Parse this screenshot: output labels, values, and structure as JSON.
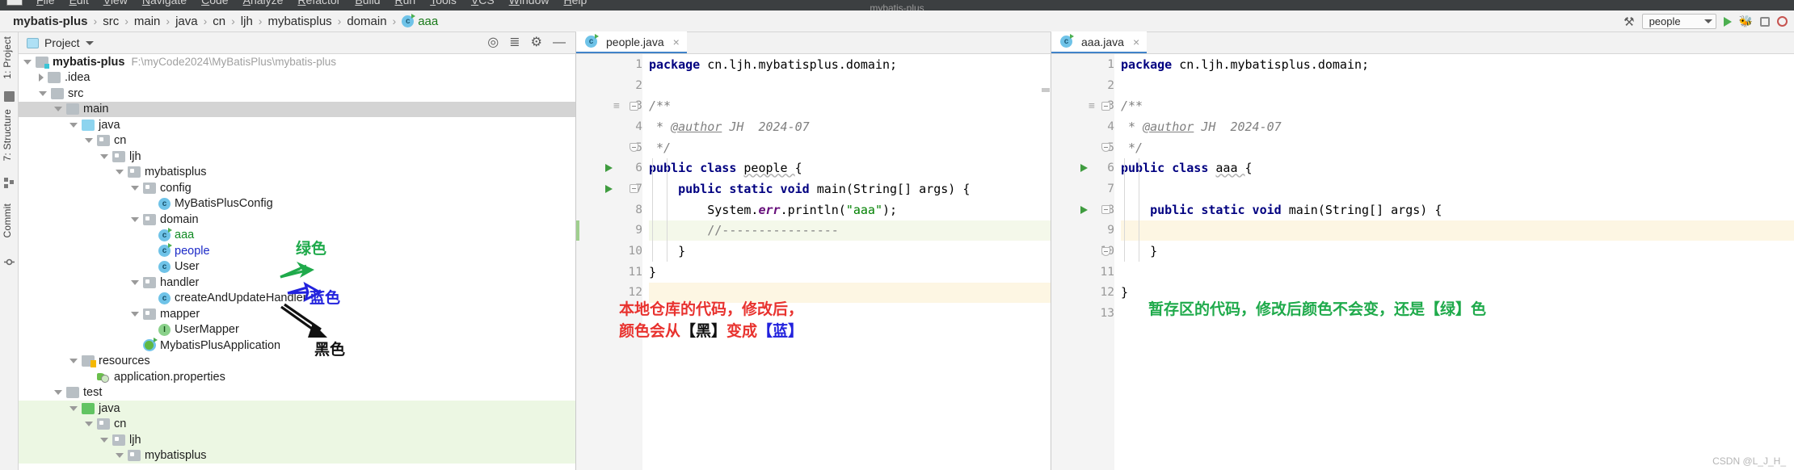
{
  "menubar": {
    "items": [
      "File",
      "Edit",
      "View",
      "Navigate",
      "Code",
      "Analyze",
      "Refactor",
      "Build",
      "Run",
      "Tools",
      "VCS",
      "Window",
      "Help"
    ],
    "window_title": "mybatis-plus"
  },
  "breadcrumb": {
    "segments": [
      "mybatis-plus",
      "src",
      "main",
      "java",
      "cn",
      "ljh",
      "mybatisplus",
      "domain",
      "aaa"
    ],
    "separator": "›",
    "last_icon": "java-class-modified-icon"
  },
  "toolbar_right": {
    "hammer_label": "⚒",
    "run_config": "people",
    "run_label": "▶",
    "debug_label": "ƀ",
    "stop_label": "■",
    "record_label": "●"
  },
  "toolstrip": {
    "tabs": [
      "1: Project",
      "7: Structure",
      "Commit"
    ]
  },
  "project_panel": {
    "header_title": "Project",
    "icons": [
      "locate-icon",
      "collapse-all-icon",
      "settings-gear-icon",
      "hide-panel-icon"
    ],
    "tree": [
      {
        "depth": 0,
        "label": "mybatis-plus",
        "path": "F:\\myCode2024\\MyBatisPlus\\mybatis-plus",
        "arrow": "open",
        "icon": "module",
        "style": "bold"
      },
      {
        "depth": 1,
        "label": ".idea",
        "arrow": "closed",
        "icon": "folder-plain"
      },
      {
        "depth": 1,
        "label": "src",
        "arrow": "open",
        "icon": "folder-plain"
      },
      {
        "depth": 2,
        "label": "main",
        "arrow": "open",
        "icon": "folder-plain",
        "selected": true
      },
      {
        "depth": 3,
        "label": "java",
        "arrow": "open",
        "icon": "folder-blue2"
      },
      {
        "depth": 4,
        "label": "cn",
        "arrow": "open",
        "icon": "folder-gray"
      },
      {
        "depth": 5,
        "label": "ljh",
        "arrow": "open",
        "icon": "folder-gray"
      },
      {
        "depth": 6,
        "label": "mybatisplus",
        "arrow": "open",
        "icon": "folder-gray"
      },
      {
        "depth": 7,
        "label": "config",
        "arrow": "open",
        "icon": "folder-gray"
      },
      {
        "depth": 8,
        "label": "MyBatisPlusConfig",
        "arrow": "none",
        "icon": "class"
      },
      {
        "depth": 7,
        "label": "domain",
        "arrow": "open",
        "icon": "folder-gray"
      },
      {
        "depth": 8,
        "label": "aaa",
        "arrow": "none",
        "icon": "class-modified",
        "style": "green"
      },
      {
        "depth": 8,
        "label": "people",
        "arrow": "none",
        "icon": "class-modified",
        "style": "blue"
      },
      {
        "depth": 8,
        "label": "User",
        "arrow": "none",
        "icon": "class"
      },
      {
        "depth": 7,
        "label": "handler",
        "arrow": "open",
        "icon": "folder-gray"
      },
      {
        "depth": 8,
        "label": "createAndUpdateHandler",
        "arrow": "none",
        "icon": "class"
      },
      {
        "depth": 7,
        "label": "mapper",
        "arrow": "open",
        "icon": "folder-gray"
      },
      {
        "depth": 8,
        "label": "UserMapper",
        "arrow": "none",
        "icon": "interface"
      },
      {
        "depth": 7,
        "label": "MybatisPlusApplication",
        "arrow": "none",
        "icon": "spring-class"
      },
      {
        "depth": 3,
        "label": "resources",
        "arrow": "open",
        "icon": "folder-resources"
      },
      {
        "depth": 4,
        "label": "application.properties",
        "arrow": "none",
        "icon": "properties"
      },
      {
        "depth": 2,
        "label": "test",
        "arrow": "open",
        "icon": "folder-plain"
      },
      {
        "depth": 3,
        "label": "java",
        "arrow": "open",
        "icon": "folder-green",
        "green_bg": true
      },
      {
        "depth": 4,
        "label": "cn",
        "arrow": "open",
        "icon": "folder-gray",
        "green_bg": true
      },
      {
        "depth": 5,
        "label": "ljh",
        "arrow": "open",
        "icon": "folder-gray",
        "green_bg": true
      },
      {
        "depth": 6,
        "label": "mybatisplus",
        "arrow": "open",
        "icon": "folder-gray",
        "green_bg": true
      }
    ],
    "annotations": [
      {
        "text": "绿色",
        "color": "#1faa4b",
        "name": "green-arrow-label"
      },
      {
        "text": "蓝色",
        "color": "#2222dd",
        "name": "blue-arrow-label"
      },
      {
        "text": "黑色",
        "color": "#111111",
        "name": "black-arrow-label"
      }
    ]
  },
  "editor_left": {
    "tab_label": "people.java",
    "tab_icon": "java-class-modified-icon",
    "close_label": "×",
    "lines": [
      {
        "n": 1,
        "tokens": [
          {
            "t": "package ",
            "c": "kw"
          },
          {
            "t": "cn.ljh.mybatisplus.domain;",
            "c": "plain"
          }
        ]
      },
      {
        "n": 2,
        "tokens": []
      },
      {
        "n": 3,
        "tokens": [
          {
            "t": "/**",
            "c": "cmt"
          }
        ],
        "fold": "start",
        "comment_mark": true
      },
      {
        "n": 4,
        "tokens": [
          {
            "t": " * ",
            "c": "cmt"
          },
          {
            "t": "@author",
            "c": "cmt-tag"
          },
          {
            "t": " JH  2024-07",
            "c": "cmt"
          }
        ]
      },
      {
        "n": 5,
        "tokens": [
          {
            "t": " */",
            "c": "cmt"
          }
        ],
        "fold": "end"
      },
      {
        "n": 6,
        "tokens": [
          {
            "t": "public class ",
            "c": "kw"
          },
          {
            "t": "people ",
            "c": "wavy"
          },
          {
            "t": "{",
            "c": "plain"
          }
        ],
        "run": true
      },
      {
        "n": 7,
        "tokens": [
          {
            "t": "    ",
            "c": "plain"
          },
          {
            "t": "public static void ",
            "c": "kw"
          },
          {
            "t": "main(String[] args) {",
            "c": "plain"
          }
        ],
        "run": true,
        "fold": "start"
      },
      {
        "n": 8,
        "tokens": [
          {
            "t": "        System.",
            "c": "plain"
          },
          {
            "t": "err",
            "c": "fld"
          },
          {
            "t": ".println(",
            "c": "plain"
          },
          {
            "t": "\"aaa\"",
            "c": "str"
          },
          {
            "t": ");",
            "c": "plain"
          }
        ]
      },
      {
        "n": 9,
        "tokens": [
          {
            "t": "        //----------------",
            "c": "cmt-ln"
          }
        ],
        "hl": true,
        "changed": true
      },
      {
        "n": 10,
        "tokens": [
          {
            "t": "    }",
            "c": "plain"
          }
        ]
      },
      {
        "n": 11,
        "tokens": [
          {
            "t": "}",
            "c": "plain"
          }
        ]
      },
      {
        "n": 12,
        "tokens": [],
        "hl_yellow": true
      }
    ],
    "note": {
      "line1_red": "本地仓库的代码，修改后，",
      "line2_a": "颜色会从",
      "line2_black": "【黑】",
      "line2_b": "变成",
      "line2_blue": "【蓝】"
    }
  },
  "editor_right": {
    "tab_label": "aaa.java",
    "tab_icon": "java-class-modified-icon",
    "close_label": "×",
    "lines": [
      {
        "n": 1,
        "tokens": [
          {
            "t": "package ",
            "c": "kw"
          },
          {
            "t": "cn.ljh.mybatisplus.domain;",
            "c": "plain"
          }
        ]
      },
      {
        "n": 2,
        "tokens": []
      },
      {
        "n": 3,
        "tokens": [
          {
            "t": "/**",
            "c": "cmt"
          }
        ],
        "fold": "start",
        "comment_mark": true
      },
      {
        "n": 4,
        "tokens": [
          {
            "t": " * ",
            "c": "cmt"
          },
          {
            "t": "@author",
            "c": "cmt-tag"
          },
          {
            "t": " JH  2024-07",
            "c": "cmt"
          }
        ]
      },
      {
        "n": 5,
        "tokens": [
          {
            "t": " */",
            "c": "cmt"
          }
        ],
        "fold": "end"
      },
      {
        "n": 6,
        "tokens": [
          {
            "t": "public class ",
            "c": "kw"
          },
          {
            "t": "aaa ",
            "c": "wavy"
          },
          {
            "t": "{",
            "c": "plain"
          }
        ],
        "run": true
      },
      {
        "n": 7,
        "tokens": []
      },
      {
        "n": 8,
        "tokens": [
          {
            "t": "    ",
            "c": "plain"
          },
          {
            "t": "public static void ",
            "c": "kw"
          },
          {
            "t": "main(String[] args) {",
            "c": "plain"
          }
        ],
        "run": true,
        "fold": "start"
      },
      {
        "n": 9,
        "tokens": [],
        "hl_yellow": true
      },
      {
        "n": 10,
        "tokens": [
          {
            "t": "    }",
            "c": "plain"
          }
        ],
        "fold": "end"
      },
      {
        "n": 11,
        "tokens": []
      },
      {
        "n": 12,
        "tokens": [
          {
            "t": "}",
            "c": "plain"
          }
        ]
      },
      {
        "n": 13,
        "tokens": []
      }
    ],
    "note": "暂存区的代码，修改后颜色不会变，还是【绿】色"
  },
  "watermark": "CSDN @L_J_H_"
}
